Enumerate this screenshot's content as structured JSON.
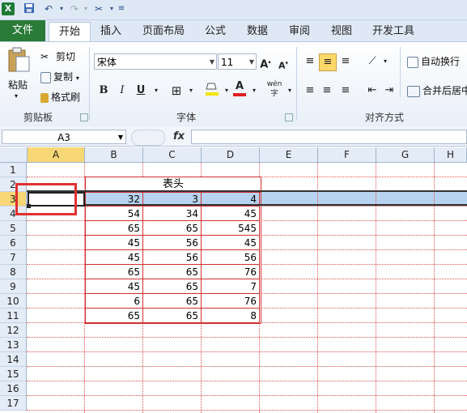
{
  "quick_access": {
    "icons": [
      "excel-logo-icon",
      "save-icon",
      "undo-icon",
      "redo-icon",
      "format-painter-icon",
      "customize-icon"
    ],
    "logo_letter": "X"
  },
  "tabs": [
    "文件",
    "开始",
    "插入",
    "页面布局",
    "公式",
    "数据",
    "审阅",
    "视图",
    "开发工具"
  ],
  "ribbon": {
    "clipboard": {
      "paste": "粘贴",
      "cut": "剪切",
      "copy": "复制",
      "format_painter": "格式刷",
      "group": "剪贴板"
    },
    "font": {
      "name": "宋体",
      "size": "11",
      "bold": "B",
      "italic": "I",
      "underline": "U",
      "font_color_letter": "A",
      "phonetic": "wén",
      "group": "字体"
    },
    "align": {
      "wrap": "自动换行",
      "merge": "合并后居中",
      "group": "对齐方式"
    }
  },
  "formula_bar": {
    "name_box": "A3",
    "fx": "fx",
    "value": ""
  },
  "sheet": {
    "columns": [
      "A",
      "B",
      "C",
      "D",
      "E",
      "F",
      "G",
      "H"
    ],
    "rows": [
      "1",
      "2",
      "3",
      "4",
      "5",
      "6",
      "7",
      "8",
      "9",
      "10",
      "11",
      "12",
      "13",
      "14",
      "15",
      "16",
      "17"
    ],
    "header_text": "表头",
    "selected_cell": "A3",
    "data": [
      [
        "32",
        "3",
        "4"
      ],
      [
        "54",
        "34",
        "45"
      ],
      [
        "65",
        "65",
        "545"
      ],
      [
        "45",
        "56",
        "45"
      ],
      [
        "45",
        "56",
        "56"
      ],
      [
        "65",
        "65",
        "76"
      ],
      [
        "45",
        "65",
        "7"
      ],
      [
        "6",
        "65",
        "76"
      ],
      [
        "65",
        "65",
        "8"
      ]
    ]
  },
  "colors": {
    "accent": "#2a7a38",
    "selection_header": "#f8d776",
    "row_highlight": "#b8d3ef",
    "annotation": "#e03030"
  }
}
